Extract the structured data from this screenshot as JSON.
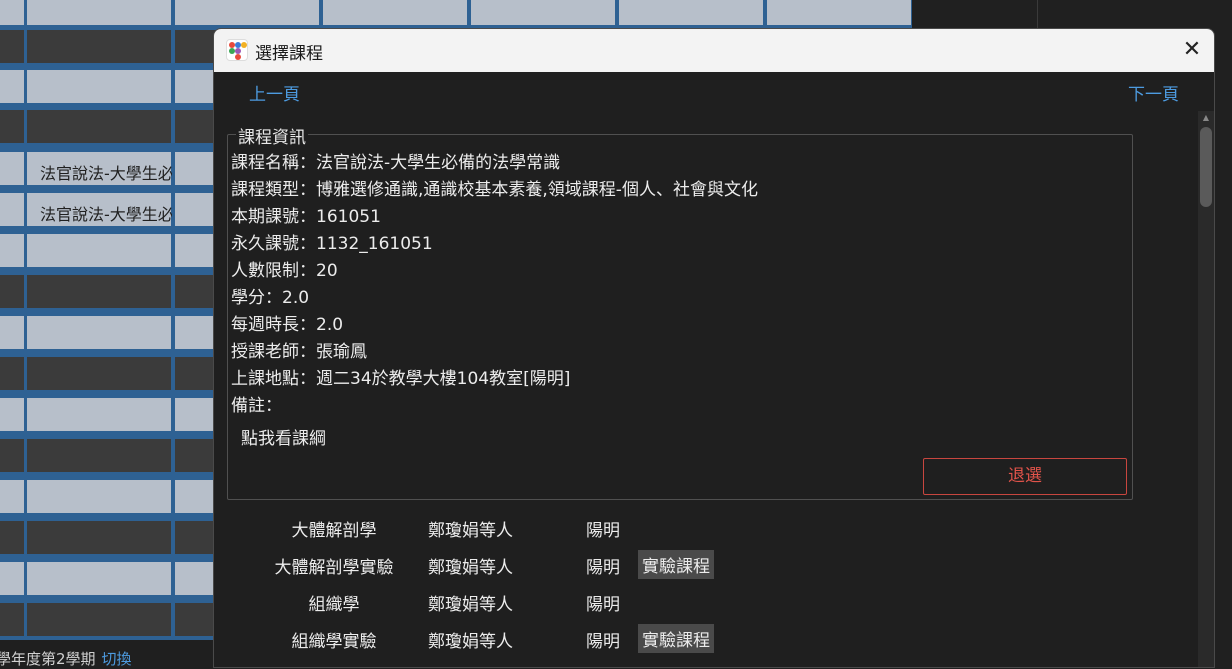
{
  "background": {
    "course_cells": [
      "法官說法-大學生必備的法學常識",
      "法官說法-大學生必備的法學常識"
    ],
    "bottom_text": "學年度第2學期",
    "bottom_link": "切換"
  },
  "dialog": {
    "title": "選擇課程",
    "close_label": "✕",
    "prev_label": "上一頁",
    "next_label": "下一頁",
    "info": {
      "legend": "課程資訊",
      "lines": [
        "課程名稱：法官說法-大學生必備的法學常識",
        "課程類型：博雅選修通識,通識校基本素養,領域課程-個人、社會與文化",
        "本期課號：161051",
        "永久課號：1132_161051",
        "人數限制：20",
        "學分：2.0",
        "每週時長：2.0",
        "授課老師：張瑜鳳",
        "上課地點：週二34於教學大樓104教室[陽明]",
        "備註："
      ],
      "syllabus_link": "點我看課綱",
      "drop_button": "退選"
    },
    "courses": [
      {
        "name": "大體解剖學",
        "teacher": "鄭瓊娟等人",
        "campus": "陽明",
        "tag": ""
      },
      {
        "name": "大體解剖學實驗",
        "teacher": "鄭瓊娟等人",
        "campus": "陽明",
        "tag": "實驗課程"
      },
      {
        "name": "組織學",
        "teacher": "鄭瓊娟等人",
        "campus": "陽明",
        "tag": ""
      },
      {
        "name": "組織學實驗",
        "teacher": "鄭瓊娟等人",
        "campus": "陽明",
        "tag": "實驗課程"
      }
    ]
  }
}
